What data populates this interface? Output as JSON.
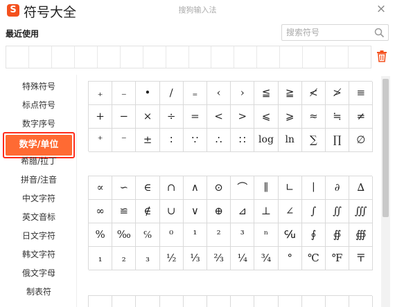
{
  "window": {
    "title": "符号大全",
    "ime_name": "搜狗输入法",
    "close_label": "×"
  },
  "recent": {
    "label": "最近使用",
    "slots": 16
  },
  "search": {
    "placeholder": "搜索符号",
    "value": ""
  },
  "icons": {
    "logo": "sogou-logo",
    "search": "search-icon",
    "trash": "trash-icon",
    "close": "close-icon"
  },
  "colors": {
    "active_bg": "#ff6a33",
    "active_border": "#ff2b1a",
    "trash": "#f4511e",
    "grid_line": "#d9d9d9"
  },
  "sidebar": {
    "items": [
      {
        "label": "特殊符号",
        "active": false
      },
      {
        "label": "标点符号",
        "active": false
      },
      {
        "label": "数字序号",
        "active": false
      },
      {
        "label": "数学/单位",
        "active": true
      },
      {
        "label": "希腊/拉丁",
        "active": false
      },
      {
        "label": "拼音/注音",
        "active": false
      },
      {
        "label": "中文字符",
        "active": false
      },
      {
        "label": "英文音标",
        "active": false
      },
      {
        "label": "日文字符",
        "active": false
      },
      {
        "label": "韩文字符",
        "active": false
      },
      {
        "label": "俄文字母",
        "active": false
      },
      {
        "label": "制表符",
        "active": false
      }
    ]
  },
  "symbols": {
    "block1": [
      [
        "₊",
        "₋",
        "•",
        "∕",
        "₌",
        "‹",
        "›",
        "≦",
        "≧",
        "≮",
        "≯",
        "≡"
      ],
      [
        "+",
        "−",
        "×",
        "÷",
        "=",
        "<",
        ">",
        "⩽",
        "⩾",
        "≈",
        "≒",
        "≠"
      ],
      [
        "⁺",
        "⁻",
        "±",
        "∶",
        "∵",
        "∴",
        "∷",
        "log",
        "ln",
        "∑",
        "∏",
        "∅"
      ]
    ],
    "block2": [
      [
        "∝",
        "∽",
        "∈",
        "∩",
        "∧",
        "⊙",
        "⌒",
        "∥",
        "∟",
        "∣",
        "∂",
        "∆"
      ],
      [
        "∞",
        "≌",
        "∉",
        "∪",
        "∨",
        "⊕",
        "⊿",
        "⊥",
        "∠",
        "∫",
        "∬",
        "∭"
      ],
      [
        "%",
        "‰",
        "℅",
        "⁰",
        "¹",
        "²",
        "³",
        "ⁿ",
        "℆",
        "∮",
        "∯",
        "∰"
      ],
      [
        "₁",
        "₂",
        "₃",
        "½",
        "⅓",
        "⅔",
        "¼",
        "¾",
        "°",
        "℃",
        "℉",
        "〒"
      ]
    ],
    "block3_partial": [
      "",
      "",
      "",
      "",
      "",
      "",
      "",
      "",
      "",
      "",
      "",
      ""
    ]
  }
}
